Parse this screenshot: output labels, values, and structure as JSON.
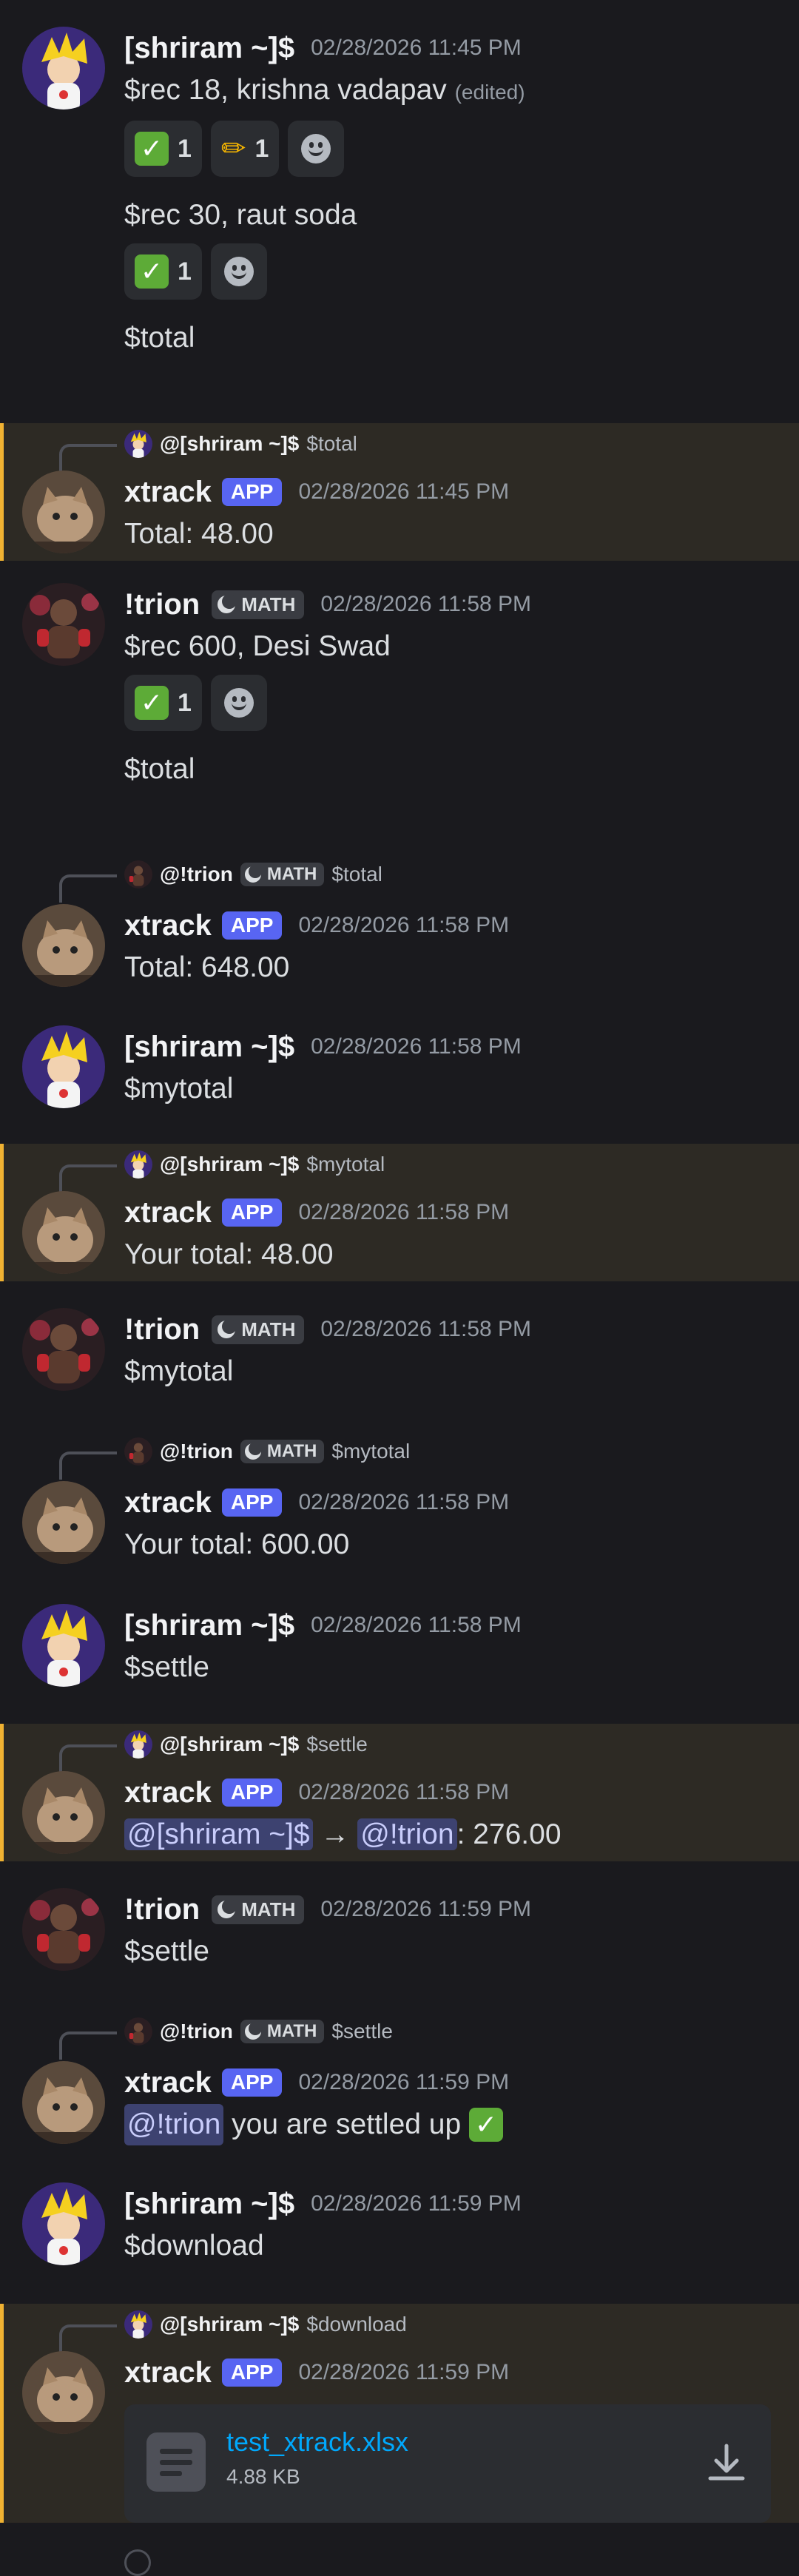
{
  "users": {
    "shriram": "[shriram ~]$",
    "trion": "!trion",
    "xtrack": "xtrack"
  },
  "badges": {
    "app": "APP",
    "math": "MATH"
  },
  "messages": {
    "m1": {
      "timestamp": "02/28/2026 11:45 PM",
      "line1": "$rec 18, krishna vadapav",
      "edited": "(edited)",
      "reactions1": [
        {
          "emoji": "check-emoji",
          "count": "1"
        },
        {
          "emoji": "pencil-emoji",
          "count": "1"
        }
      ],
      "line2": "$rec 30, raut soda",
      "reactions2": [
        {
          "emoji": "check-emoji",
          "count": "1"
        }
      ],
      "line3": "$total"
    },
    "m2": {
      "reply_mention": "@[shriram ~]$",
      "reply_text": "$total",
      "timestamp": "02/28/2026 11:45 PM",
      "text": "Total: 48.00"
    },
    "m3": {
      "timestamp": "02/28/2026 11:58 PM",
      "line1": "$rec 600, Desi Swad",
      "reactions1": [
        {
          "emoji": "check-emoji",
          "count": "1"
        }
      ],
      "line2": "$total"
    },
    "m4": {
      "reply_mention": "@!trion",
      "reply_text": "$total",
      "timestamp": "02/28/2026 11:58 PM",
      "text": "Total: 648.00"
    },
    "m5": {
      "timestamp": "02/28/2026 11:58 PM",
      "text": "$mytotal"
    },
    "m6": {
      "reply_mention": "@[shriram ~]$",
      "reply_text": "$mytotal",
      "timestamp": "02/28/2026 11:58 PM",
      "text": "Your total: 48.00"
    },
    "m7": {
      "timestamp": "02/28/2026 11:58 PM",
      "text": "$mytotal"
    },
    "m8": {
      "reply_mention": "@!trion",
      "reply_text": "$mytotal",
      "timestamp": "02/28/2026 11:58 PM",
      "text": "Your total: 600.00"
    },
    "m9": {
      "timestamp": "02/28/2026 11:58 PM",
      "text": "$settle"
    },
    "m10": {
      "reply_mention": "@[shriram ~]$",
      "reply_text": "$settle",
      "timestamp": "02/28/2026 11:58 PM",
      "from_mention": "@[shriram ~]$",
      "arrow": "→",
      "to_mention": "@!trion",
      "amount": ": 276.00"
    },
    "m11": {
      "timestamp": "02/28/2026 11:59 PM",
      "text": "$settle"
    },
    "m12": {
      "reply_mention": "@!trion",
      "reply_text": "$settle",
      "timestamp": "02/28/2026 11:59 PM",
      "mention": "@!trion",
      "text": " you are settled up "
    },
    "m13": {
      "timestamp": "02/28/2026 11:59 PM",
      "text": "$download"
    },
    "m14": {
      "reply_mention": "@[shriram ~]$",
      "reply_text": "$download",
      "timestamp": "02/28/2026 11:59 PM",
      "file_name": "test_xtrack.xlsx",
      "file_size": "4.88 KB"
    }
  },
  "colors": {
    "accent": "#5865f2",
    "highlight_bar": "#f0b232",
    "link": "#00a8fc",
    "mention_bg": "#3d4270"
  }
}
